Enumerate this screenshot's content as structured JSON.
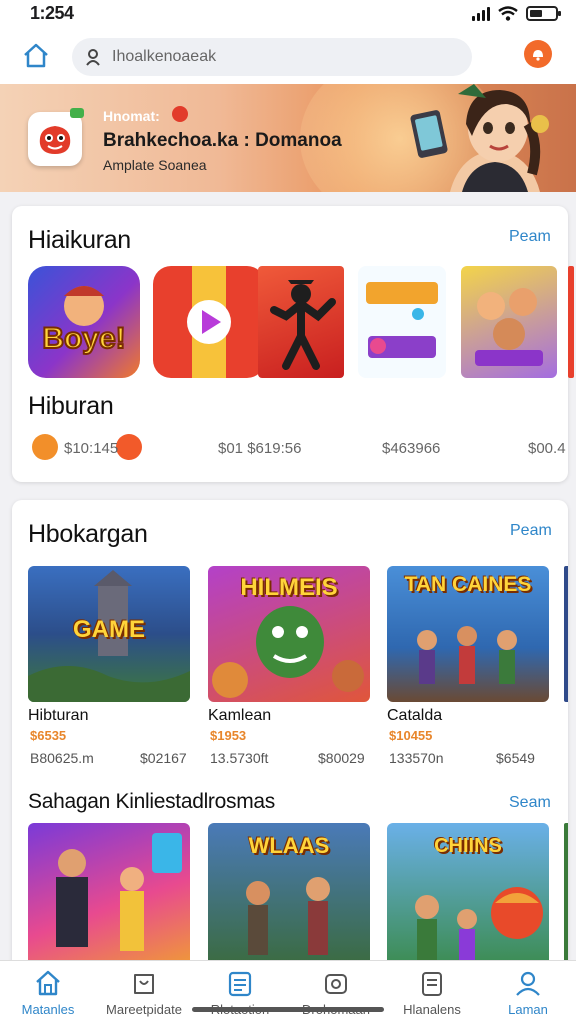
{
  "status_bar": {
    "time": "1:254"
  },
  "search": {
    "placeholder": "Ihoalkenoaeak"
  },
  "banner": {
    "kicker": "Hnomat:",
    "title": "Brahkechoa.ka : Domanoa",
    "subtitle": "Amplate Soanea"
  },
  "section1": {
    "title": "Hiaikuran",
    "see_all": "Peam",
    "apps": [
      {
        "name": "boye-game-icon"
      },
      {
        "name": "video-player-icon"
      },
      {
        "name": "ninja-game-icon"
      },
      {
        "name": "puzzle-game-icon"
      },
      {
        "name": "party-game-icon"
      }
    ],
    "subtitle": "Hiburan",
    "prices": [
      "$10:145",
      "$01 $619:56",
      "$463966",
      "$00.4"
    ]
  },
  "section2": {
    "title": "Hbokargan",
    "see_all": "Peam",
    "games": [
      {
        "label": "Hibturan",
        "price": "$6535",
        "rating": "B80625.m",
        "value": "$02167",
        "thumb_text": "GAME"
      },
      {
        "label": "Kamlean",
        "price": "$1953",
        "rating": "13.5730ft",
        "value": "$80029",
        "thumb_text": "HILMEIS"
      },
      {
        "label": "Catalda",
        "price": "$10455",
        "rating": "133570n",
        "value": "$6549",
        "thumb_text": "TAN CAINES"
      }
    ]
  },
  "section3": {
    "title": "Sahagan Kinliestadlrosmas",
    "see_all": "Seam",
    "thumbs": [
      {
        "thumb_text": ""
      },
      {
        "thumb_text": "WLAAS"
      },
      {
        "thumb_text": "CHIINS"
      }
    ]
  },
  "bottom_nav": [
    {
      "label": "Matanles",
      "icon": "home-icon",
      "active": true
    },
    {
      "label": "Mareetpidate",
      "icon": "store-icon",
      "active": false
    },
    {
      "label": "Rlotaotion",
      "icon": "list-icon",
      "active": false
    },
    {
      "label": "Drohomaan",
      "icon": "camera-icon",
      "active": false
    },
    {
      "label": "Hlanalens",
      "icon": "doc-icon",
      "active": false
    },
    {
      "label": "Laman",
      "icon": "profile-icon",
      "active": true
    }
  ],
  "colors": {
    "accent": "#2f86c9",
    "price": "#e8862b",
    "notif": "#f26a2a"
  }
}
